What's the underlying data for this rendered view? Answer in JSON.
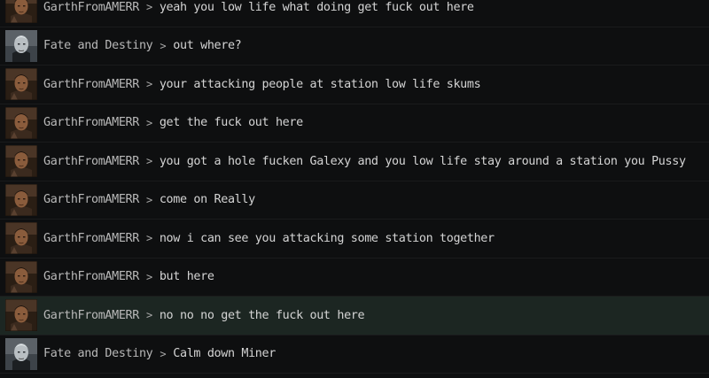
{
  "separator": ">",
  "avatars": {
    "garth": {
      "icon": "male-pilot-portrait-icon",
      "bg": "#2a1e14",
      "skin": "#8a5c3c",
      "hair": "#1b120c",
      "suit": "#3b2a1e"
    },
    "fate": {
      "icon": "helmeted-pilot-portrait-icon",
      "bg": "#3d4349",
      "skin": "#b9bfc3",
      "hair": "#e9eef0",
      "suit": "#1c1f22"
    }
  },
  "messages": [
    {
      "sender": "GarthFromAMERR",
      "avatar": "garth",
      "text": "yeah you low life what doing get fuck out here",
      "highlighted": false
    },
    {
      "sender": "Fate and Destiny",
      "avatar": "fate",
      "text": "out where?",
      "highlighted": false
    },
    {
      "sender": "GarthFromAMERR",
      "avatar": "garth",
      "text": "your attacking people at station low life skums",
      "highlighted": false
    },
    {
      "sender": "GarthFromAMERR",
      "avatar": "garth",
      "text": "get the fuck out here",
      "highlighted": false
    },
    {
      "sender": "GarthFromAMERR",
      "avatar": "garth",
      "text": "you got a hole fucken Galexy and you low life stay around a station you Pussy",
      "highlighted": false
    },
    {
      "sender": "GarthFromAMERR",
      "avatar": "garth",
      "text": "come on Really",
      "highlighted": false
    },
    {
      "sender": "GarthFromAMERR",
      "avatar": "garth",
      "text": "now i can see you attacking some station together",
      "highlighted": false
    },
    {
      "sender": "GarthFromAMERR",
      "avatar": "garth",
      "text": "but here",
      "highlighted": false
    },
    {
      "sender": "GarthFromAMERR",
      "avatar": "garth",
      "text": "no no no get the fuck out here",
      "highlighted": true
    },
    {
      "sender": "Fate and Destiny",
      "avatar": "fate",
      "text": "Calm down Miner",
      "highlighted": false
    }
  ]
}
